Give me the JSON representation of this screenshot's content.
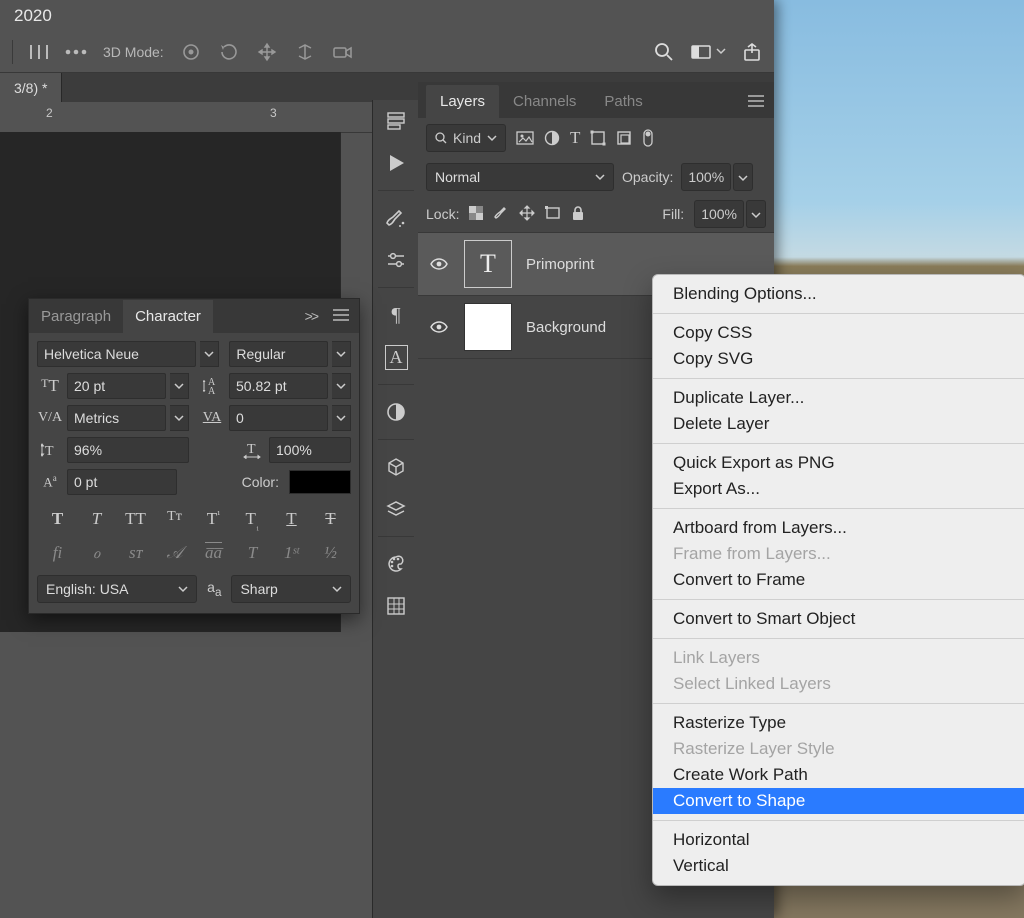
{
  "titlebar": {
    "app_title_fragment": "2020"
  },
  "options_bar": {
    "mode_label": "3D Mode:"
  },
  "doc_tab": {
    "label": "3/8) *"
  },
  "ruler": {
    "ticks": [
      "2",
      "3"
    ]
  },
  "dock": {
    "items": [
      "history-icon",
      "play-icon",
      "brush-icon",
      "adjust-icon",
      "paragraph-icon",
      "character-icon",
      "contrast-icon",
      "3d-icon",
      "layers-small-icon",
      "palette-icon",
      "grid-icon"
    ]
  },
  "layers_panel": {
    "tabs": [
      "Layers",
      "Channels",
      "Paths"
    ],
    "active_tab": 0,
    "kind_label": "Kind",
    "blend_mode": "Normal",
    "opacity_label": "Opacity:",
    "opacity_value": "100%",
    "lock_label": "Lock:",
    "fill_label": "Fill:",
    "fill_value": "100%",
    "layers": [
      {
        "name": "Primoprint",
        "type": "text",
        "selected": true
      },
      {
        "name": "Background",
        "type": "pixel",
        "selected": false
      }
    ]
  },
  "char_panel": {
    "tabs": [
      "Paragraph",
      "Character"
    ],
    "active_tab": 1,
    "font_family": "Helvetica Neue",
    "font_style": "Regular",
    "font_size": "20 pt",
    "leading": "50.82 pt",
    "kerning": "Metrics",
    "tracking": "0",
    "v_scale": "96%",
    "h_scale": "100%",
    "baseline": "0 pt",
    "color_label": "Color:",
    "color": "#000000",
    "lang": "English: USA",
    "aa_label": "aₐ",
    "aa_mode": "Sharp"
  },
  "context_menu": {
    "items": [
      {
        "label": "Blending Options...",
        "disabled": false
      },
      {
        "sep": true
      },
      {
        "label": "Copy CSS",
        "disabled": false
      },
      {
        "label": "Copy SVG",
        "disabled": false
      },
      {
        "sep": true
      },
      {
        "label": "Duplicate Layer...",
        "disabled": false
      },
      {
        "label": "Delete Layer",
        "disabled": false
      },
      {
        "sep": true
      },
      {
        "label": "Quick Export as PNG",
        "disabled": false
      },
      {
        "label": "Export As...",
        "disabled": false
      },
      {
        "sep": true
      },
      {
        "label": "Artboard from Layers...",
        "disabled": false
      },
      {
        "label": "Frame from Layers...",
        "disabled": true
      },
      {
        "label": "Convert to Frame",
        "disabled": false
      },
      {
        "sep": true
      },
      {
        "label": "Convert to Smart Object",
        "disabled": false
      },
      {
        "sep": true
      },
      {
        "label": "Link Layers",
        "disabled": true
      },
      {
        "label": "Select Linked Layers",
        "disabled": true
      },
      {
        "sep": true
      },
      {
        "label": "Rasterize Type",
        "disabled": false
      },
      {
        "label": "Rasterize Layer Style",
        "disabled": true
      },
      {
        "label": "Create Work Path",
        "disabled": false
      },
      {
        "label": "Convert to Shape",
        "disabled": false,
        "highlight": true
      },
      {
        "sep": true
      },
      {
        "label": "Horizontal",
        "disabled": false
      },
      {
        "label": "Vertical",
        "disabled": false
      }
    ]
  }
}
